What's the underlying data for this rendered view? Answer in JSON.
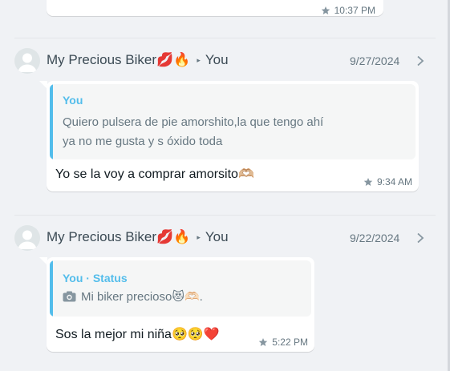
{
  "top_message": {
    "time": "10:37 PM"
  },
  "chats": [
    {
      "contact_name": "My Precious Biker💋🔥",
      "arrow": "▸",
      "you_label": "You",
      "date": "9/27/2024",
      "quote_author": "You",
      "quote_text": "Quiero pulsera de pie amorshito,la que tengo ahí ya no me gusta y s óxido toda",
      "message": "Yo se la voy a comprar amorsito🫶🏼",
      "time": "9:34 AM"
    },
    {
      "contact_name": "My Precious Biker💋🔥",
      "arrow": "▸",
      "you_label": "You",
      "date": "9/22/2024",
      "quote_author": "You · Status",
      "quote_text": "Mi biker precioso😻🫶🏻.",
      "message": "Sos la mejor mi niña🥺🥺❤️",
      "time": "5:22 PM"
    }
  ],
  "icons": {
    "star": "star-icon",
    "chevron": "chevron-right-icon",
    "avatar": "default-avatar-icon",
    "camera": "camera-icon"
  },
  "colors": {
    "background": "#f0f2f5",
    "bubble": "#ffffff",
    "quote_accent": "#53bdeb",
    "meta": "#667781"
  }
}
